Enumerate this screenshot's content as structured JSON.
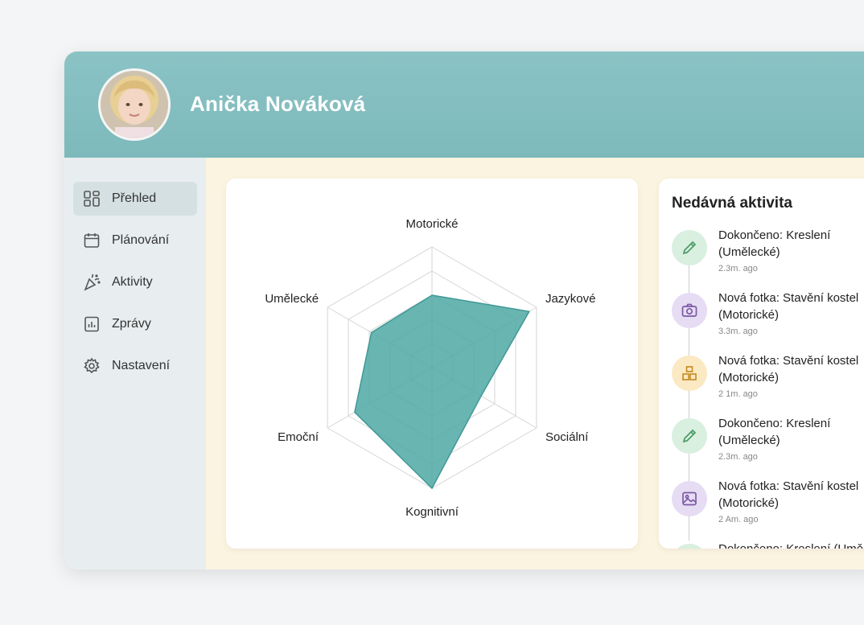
{
  "user": {
    "name": "Anička Nováková"
  },
  "sidebar": {
    "items": [
      {
        "label": "Přehled",
        "icon": "dashboard-icon",
        "active": true
      },
      {
        "label": "Plánování",
        "icon": "calendar-icon",
        "active": false
      },
      {
        "label": "Aktivity",
        "icon": "party-popper-icon",
        "active": false
      },
      {
        "label": "Zprávy",
        "icon": "report-chart-icon",
        "active": false
      },
      {
        "label": "Nastavení",
        "icon": "gear-icon",
        "active": false
      }
    ]
  },
  "chart_data": {
    "type": "radar",
    "axes": [
      "Motorické",
      "Jazykové",
      "Sociální",
      "Kognitivní",
      "Emoční",
      "Umělecké"
    ],
    "values": [
      0.6,
      0.93,
      0.47,
      1.0,
      0.74,
      0.58
    ],
    "range": [
      0,
      1
    ],
    "grid_levels": 5,
    "color": "#4fa8a4"
  },
  "activity": {
    "title": "Nedávná aktivita",
    "items": [
      {
        "text": "Dokončeno: Kreslení\n(Umělecké)",
        "time": "2.3m. ago",
        "icon": "pencil-icon",
        "bg": "#d9efdf",
        "fg": "#4a9a66"
      },
      {
        "text": "Nová fotka: Stavění kostel\n(Motorické)",
        "time": "3.3m. ago",
        "icon": "camera-icon",
        "bg": "#e6dcf3",
        "fg": "#7d5aa6"
      },
      {
        "text": "Nová fotka: Stavění kostel\n(Motorické)",
        "time": "2 1m. ago",
        "icon": "blocks-icon",
        "bg": "#fbe9c3",
        "fg": "#c48a1f"
      },
      {
        "text": "Dokončeno: Kreslení\n(Umělecké)",
        "time": "2.3m. ago",
        "icon": "pencil-icon",
        "bg": "#d9efdf",
        "fg": "#4a9a66"
      },
      {
        "text": "Nová fotka: Stavění kostel\n(Motorické)",
        "time": "2 Am. ago",
        "icon": "image-icon",
        "bg": "#e6dcf3",
        "fg": "#7d5aa6"
      },
      {
        "text": "Dokončeno: Kreslení (Umě",
        "time": "",
        "icon": "pencil-icon",
        "bg": "#d9efdf",
        "fg": "#4a9a66"
      }
    ]
  },
  "colors": {
    "header": "#7db9bb",
    "sidebar": "#e8eef0",
    "content_bg": "#fbf4e1",
    "radar_fill": "#4fa8a4"
  }
}
